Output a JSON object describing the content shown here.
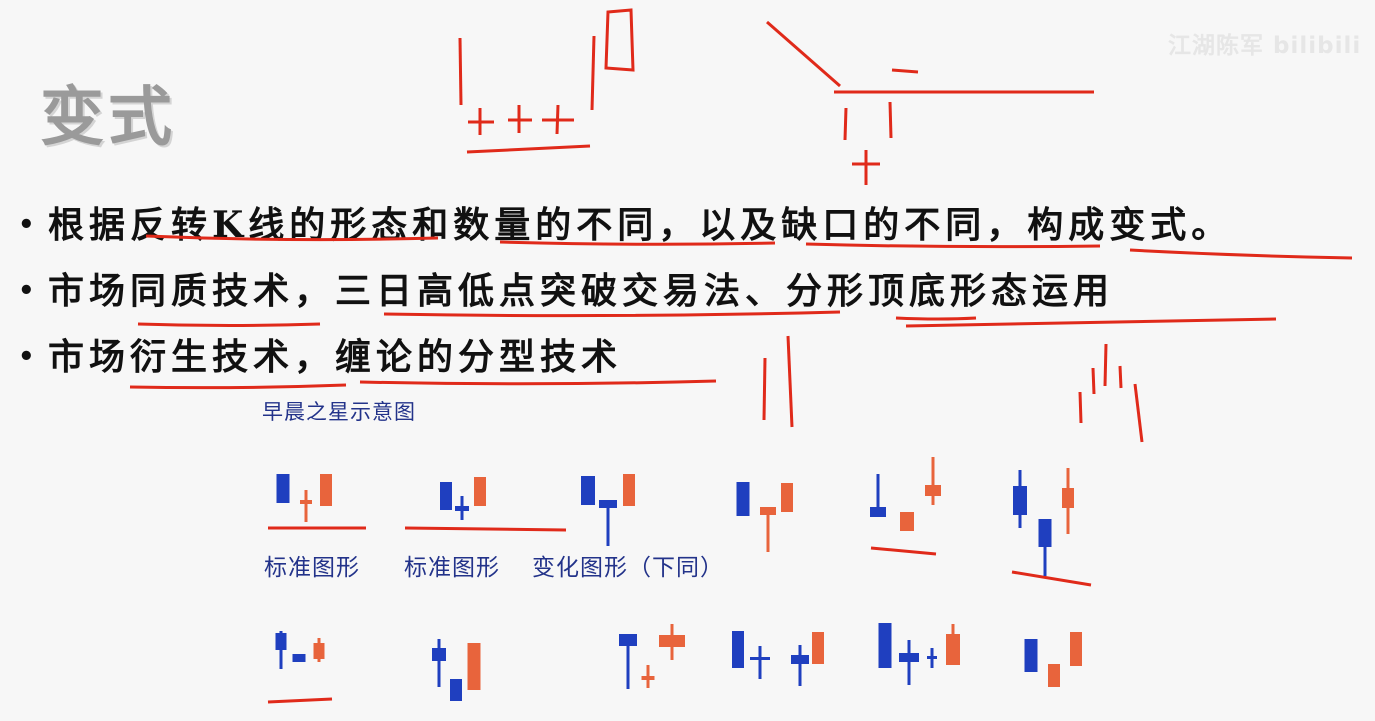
{
  "slide": {
    "title": "变式",
    "bullets": [
      "根据反转K线的形态和数量的不同，以及缺口的不同，构成变式。",
      "市场同质技术，三日高低点突破交易法、分形顶底形态运用",
      "市场衍生技术，缠论的分型技术"
    ]
  },
  "figure": {
    "title": "早晨之星示意图",
    "labels": [
      "标准图形",
      "标准图形",
      "变化图形（下同）"
    ]
  },
  "watermark": {
    "text": "江湖陈军 bilibili"
  },
  "colors": {
    "bull": "#e8643c",
    "bear": "#1f3fbf",
    "annotation": "#e02a1a",
    "label": "#23338a"
  }
}
